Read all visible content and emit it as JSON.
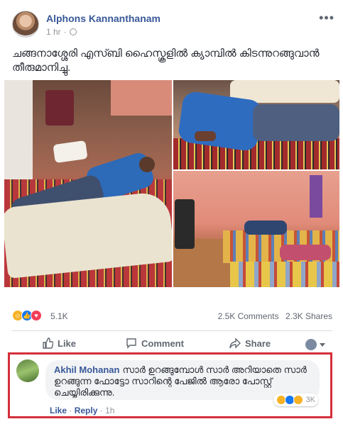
{
  "post": {
    "author": "Alphons Kannanthanam",
    "time": "1 hr",
    "more_icon": "•••",
    "text": "ചങ്ങനാശ്ശേരി എസ്ബി ഹൈസ്കൂളിൽ ക്യാമ്പിൽ കിടന്നുറങ്ങുവാൻ തീരുമാനിച്ചു."
  },
  "reactions": {
    "count": "5.1K",
    "comments": "2.5K Comments",
    "shares": "2.3K Shares"
  },
  "actions": {
    "like": "Like",
    "comment": "Comment",
    "share": "Share"
  },
  "comment": {
    "author": "Akhil Mohanan",
    "text": "സാർ ഉറങ്ങുമ്പോൾ സാർ അറിയാതെ സാർ ഉറങ്ങുന്ന ഫോട്ടോ സാറിന്റെ പേജിൽ ആരോ പോസ്റ്റ് ചെയ്യിരിക്കുന്നു.",
    "reaction_count": "3K",
    "like": "Like",
    "reply": "Reply",
    "separator": "·",
    "time": "1h"
  },
  "colors": {
    "link": "#385898",
    "like_blue": "#1877f2",
    "love_red": "#f33e58",
    "haha_yellow": "#f7b125",
    "highlight_border": "#d4303a"
  }
}
